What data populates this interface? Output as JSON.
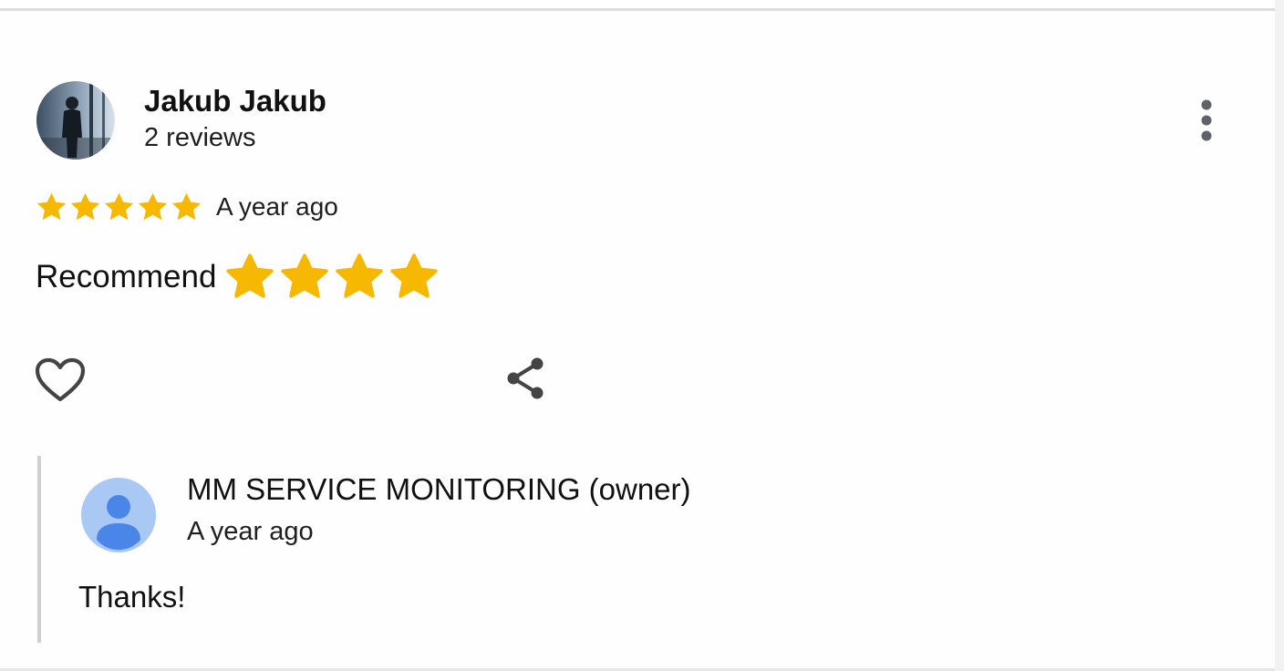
{
  "review": {
    "reviewer": {
      "name": "Jakub Jakub",
      "review_count": "2 reviews",
      "avatar_icon": "profile-photo-person-at-window"
    },
    "rating": 5,
    "rating_max": 5,
    "time": "A year ago",
    "text": "Recommend",
    "text_emoji_stars": 4,
    "star_color": "#F6B800",
    "actions": {
      "more_icon": "more-vertical-icon",
      "like_icon": "heart-outline-icon",
      "share_icon": "share-icon"
    }
  },
  "owner_reply": {
    "name": "MM SERVICE MONITORING (owner)",
    "time": "A year ago",
    "text": "Thanks!",
    "avatar_icon": "default-person-avatar-icon",
    "avatar_color": "#4A86E8"
  }
}
